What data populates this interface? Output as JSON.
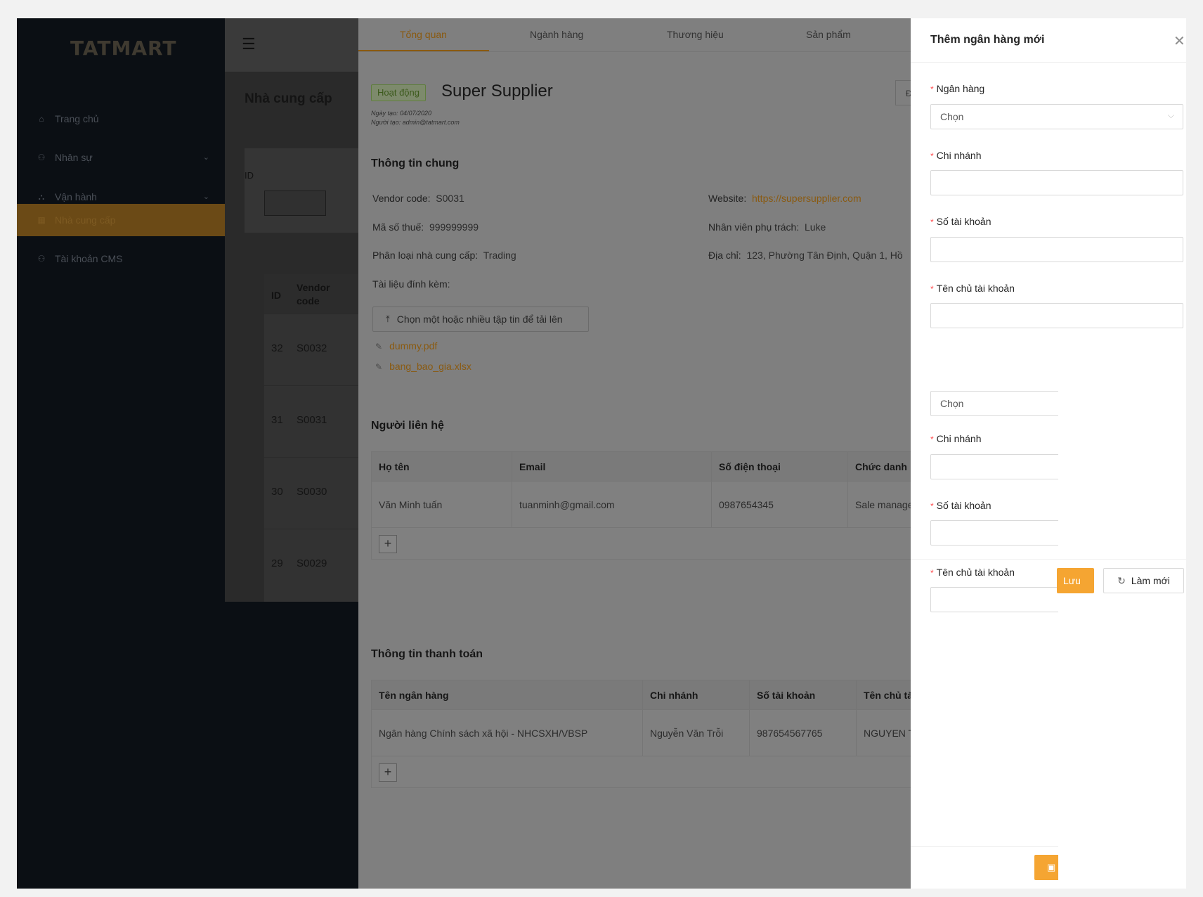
{
  "brand": {
    "logo": "TATMART",
    "accent": "#f5a532",
    "sidebar_bg": "#0b0f14"
  },
  "sidebar": {
    "items": [
      {
        "label": "Trang chủ",
        "icon": "home-icon"
      },
      {
        "label": "Nhân sự",
        "icon": "users-icon",
        "expandable": true
      },
      {
        "label": "Vận hành",
        "icon": "cluster-icon",
        "expandable": true
      },
      {
        "label": "Nhà cung cấp",
        "icon": "table-icon",
        "active": true
      },
      {
        "label": "Tài khoản CMS",
        "icon": "user-icon"
      }
    ]
  },
  "list": {
    "page_title": "Nhà cung cấp",
    "filter_label": "ID",
    "columns": [
      "ID",
      "Vendor code"
    ],
    "rows": [
      {
        "id": "32",
        "code": "S0032"
      },
      {
        "id": "31",
        "code": "S0031"
      },
      {
        "id": "30",
        "code": "S0030"
      },
      {
        "id": "29",
        "code": "S0029"
      }
    ]
  },
  "detail": {
    "tabs": [
      "Tổng quan",
      "Ngành hàng",
      "Thương hiệu",
      "Sản phẩm"
    ],
    "active_tab": "Tổng quan",
    "status": "Hoạt động",
    "name": "Super Supplier",
    "created_date": "Ngày tạo: 04/07/2020",
    "created_by": "Người tạo: admin@tatmart.com",
    "edit_button": "Đ",
    "general": {
      "title": "Thông tin chung",
      "vendor_code_label": "Vendor code",
      "vendor_code": "S0031",
      "tax_label": "Mã số thuế",
      "tax": "999999999",
      "type_label": "Phân loại nhà cung cấp",
      "type": "Trading",
      "attachments_label": "Tài liệu đính kèm",
      "website_label": "Website",
      "website": "https://supersupplier.com",
      "staff_label": "Nhân viên phụ trách",
      "staff": "Luke",
      "address_label": "Địa chỉ",
      "address": "123, Phường Tân Định, Quận 1, Hồ",
      "upload_button": "Chọn một hoặc nhiều tập tin để tải lên",
      "files": [
        "dummy.pdf",
        "bang_bao_gia.xlsx"
      ]
    },
    "contacts": {
      "title": "Người liên hệ",
      "columns": [
        "Họ tên",
        "Email",
        "Số điện thoại",
        "Chức danh"
      ],
      "rows": [
        {
          "name": "Văn Minh tuấn",
          "email": "tuanminh@gmail.com",
          "phone": "0987654345",
          "title": "Sale manage"
        }
      ],
      "add": "+"
    },
    "payment": {
      "title": "Thông tin thanh toán",
      "columns": [
        "Tên ngân hàng",
        "Chi nhánh",
        "Số tài khoản",
        "Tên chủ tà"
      ],
      "rows": [
        {
          "bank": "Ngân hàng Chính sách xã hội - NHCSXH/VBSP",
          "branch": "Nguyễn Văn Trỗi",
          "account": "987654567765",
          "holder": "NGUYEN T"
        }
      ],
      "add": "+"
    }
  },
  "drawer": {
    "title": "Thêm ngân hàng mới",
    "bank_label": "Ngân hàng",
    "bank_placeholder": "Chọn",
    "branch_label": "Chi nhánh",
    "account_label": "Số tài khoản",
    "holder_label": "Tên chủ tài khoản",
    "ghost": {
      "bank_placeholder": "Chọn",
      "branch_label": "Chi nhánh",
      "account_label": "Số tài khoản",
      "holder_label": "Tên chủ tài khoản"
    },
    "save_button": "Lưu",
    "reset_button": "Làm mới"
  }
}
